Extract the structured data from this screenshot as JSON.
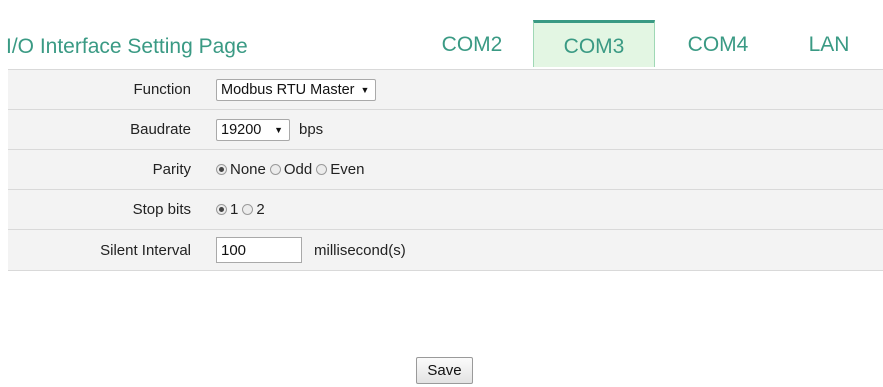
{
  "header": {
    "title": "I/O Interface Setting Page",
    "tabs": [
      {
        "label": "COM2",
        "active": false
      },
      {
        "label": "COM3",
        "active": true
      },
      {
        "label": "COM4",
        "active": false
      },
      {
        "label": "LAN",
        "active": false
      }
    ]
  },
  "form": {
    "function": {
      "label": "Function",
      "selected": "Modbus RTU Master"
    },
    "baudrate": {
      "label": "Baudrate",
      "selected": "19200",
      "unit": "bps"
    },
    "parity": {
      "label": "Parity",
      "options": [
        "None",
        "Odd",
        "Even"
      ],
      "selected": "None"
    },
    "stop_bits": {
      "label": "Stop bits",
      "options": [
        "1",
        "2"
      ],
      "selected": "1"
    },
    "silent_interval": {
      "label": "Silent Interval",
      "value": "100",
      "unit": "millisecond(s)"
    }
  },
  "actions": {
    "save_label": "Save"
  },
  "colors": {
    "accent": "#3a9a84",
    "active_tab_bg": "#e3f6e3",
    "row_bg": "#f3f3f3"
  }
}
